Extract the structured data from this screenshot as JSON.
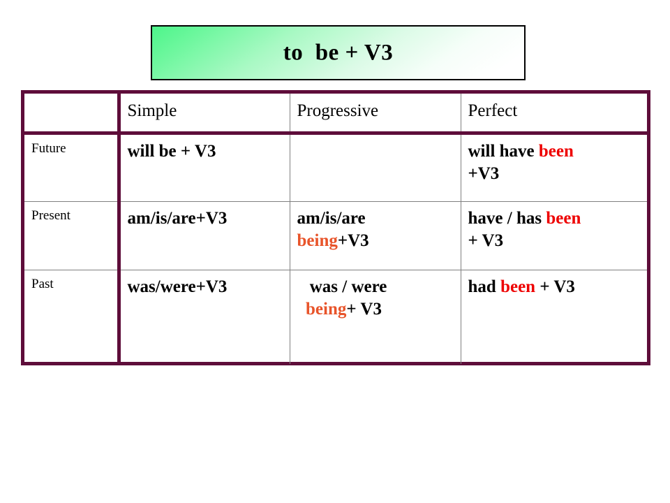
{
  "title": {
    "text": "to  be + V3",
    "box_border_color": "#000000",
    "gradient_from": "#4df58a",
    "gradient_to": "#ffffff"
  },
  "table": {
    "border_color": "#5e0d3a",
    "grid_color": "#808080",
    "accent_red": "#ee0000",
    "accent_orange": "#e8542a",
    "corner_header": "",
    "columns": [
      "Simple",
      "Progressive",
      "Perfect"
    ],
    "rows": [
      {
        "label": "Future",
        "simple": [
          {
            "text": "will be + V3",
            "color": "black"
          }
        ],
        "progressive": [],
        "perfect": [
          {
            "text": "will have ",
            "color": "black"
          },
          {
            "text": "been",
            "color": "red"
          },
          {
            "text": "\n+V3",
            "color": "black"
          }
        ]
      },
      {
        "label": "Present",
        "simple": [
          {
            "text": "am/is/are+V3",
            "color": "black"
          }
        ],
        "progressive": [
          {
            "text": "am/is/are\n",
            "color": "black"
          },
          {
            "text": "being",
            "color": "orange"
          },
          {
            "text": "+V3",
            "color": "black"
          }
        ],
        "perfect": [
          {
            "text": "have / has ",
            "color": "black"
          },
          {
            "text": "been",
            "color": "red"
          },
          {
            "text": "\n+ V3",
            "color": "black"
          }
        ]
      },
      {
        "label": "Past",
        "simple": [
          {
            "text": "was/were+V3",
            "color": "black"
          }
        ],
        "progressive": [
          {
            "text": " was / were\n  ",
            "color": "black"
          },
          {
            "text": "being",
            "color": "orange"
          },
          {
            "text": "+ V3",
            "color": "black"
          }
        ],
        "perfect": [
          {
            "text": "had ",
            "color": "black"
          },
          {
            "text": "been",
            "color": "red"
          },
          {
            "text": " + V3",
            "color": "black"
          }
        ]
      }
    ]
  }
}
